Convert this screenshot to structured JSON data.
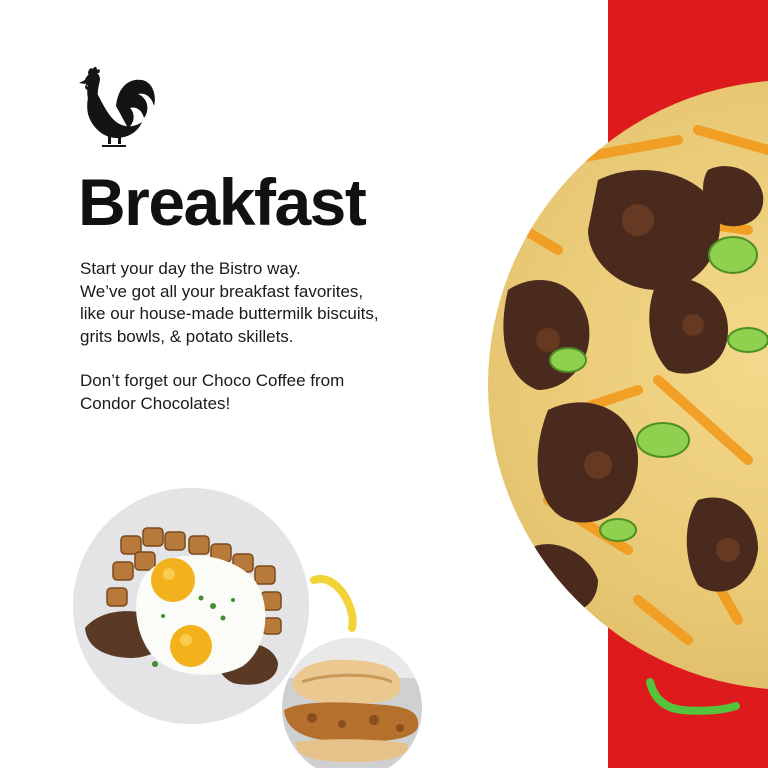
{
  "title": "Breakfast",
  "body": {
    "line_1": "Start your day the Bistro way.",
    "line_2": "We’ve got all your breakfast favorites,",
    "line_3": "like our house-made buttermilk biscuits,",
    "line_4": "grits bowls, & potato skillets.",
    "line_5": "Don’t forget our Choco Coffee from",
    "line_6": "Condor Chocolates!"
  },
  "icons": {
    "logo": "rooster-icon"
  },
  "colors": {
    "accent_red": "#dd1b1d",
    "accent_yellow": "#f2d33a",
    "accent_green": "#55c43c",
    "text_dark": "#111111"
  }
}
